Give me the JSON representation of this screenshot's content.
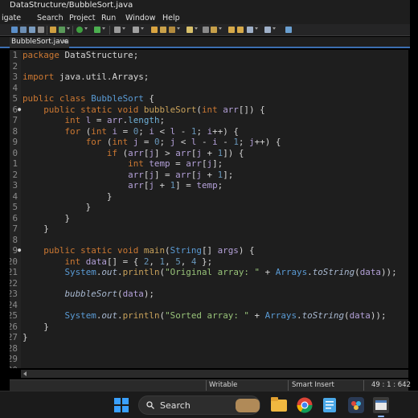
{
  "window": {
    "title": "DataStructure/BubbleSort.java"
  },
  "menu": [
    "igate",
    "Search",
    "Project",
    "Run",
    "Window",
    "Help"
  ],
  "tab": {
    "label": "BubbleSort.java",
    "close": "×"
  },
  "editor": {
    "lines": [
      {
        "n": "1",
        "fold": "",
        "t": [
          [
            "kw",
            "package"
          ],
          [
            "op",
            " DataStructure;"
          ]
        ]
      },
      {
        "n": "2",
        "fold": "",
        "t": []
      },
      {
        "n": "3",
        "fold": "",
        "t": [
          [
            "kw",
            "import"
          ],
          [
            "op",
            " java.util.Arrays;"
          ]
        ]
      },
      {
        "n": "4",
        "fold": "",
        "t": []
      },
      {
        "n": "5",
        "fold": "",
        "t": [
          [
            "kw",
            "public class "
          ],
          [
            "cls",
            "BubbleSort"
          ],
          [
            "op",
            " {"
          ]
        ]
      },
      {
        "n": "6",
        "fold": "●",
        "t": [
          [
            "op",
            "    "
          ],
          [
            "kw",
            "public static void "
          ],
          [
            "mth",
            "bubbleSort"
          ],
          [
            "op",
            "("
          ],
          [
            "ty",
            "int"
          ],
          [
            "op",
            " "
          ],
          [
            "var",
            "arr"
          ],
          [
            "op",
            "[]) {"
          ]
        ]
      },
      {
        "n": "7",
        "fold": "",
        "t": [
          [
            "op",
            "        "
          ],
          [
            "ty",
            "int"
          ],
          [
            "op",
            " "
          ],
          [
            "var",
            "l"
          ],
          [
            "op",
            " = "
          ],
          [
            "var",
            "arr"
          ],
          [
            "op",
            "."
          ],
          [
            "fld",
            "length"
          ],
          [
            "op",
            ";"
          ]
        ]
      },
      {
        "n": "8",
        "fold": "",
        "t": [
          [
            "op",
            "        "
          ],
          [
            "kw",
            "for"
          ],
          [
            "op",
            " ("
          ],
          [
            "ty",
            "int"
          ],
          [
            "op",
            " "
          ],
          [
            "var",
            "i"
          ],
          [
            "op",
            " = "
          ],
          [
            "num",
            "0"
          ],
          [
            "op",
            "; "
          ],
          [
            "var",
            "i"
          ],
          [
            "op",
            " < "
          ],
          [
            "var",
            "l"
          ],
          [
            "op",
            " - "
          ],
          [
            "num",
            "1"
          ],
          [
            "op",
            "; "
          ],
          [
            "var",
            "i"
          ],
          [
            "op",
            "++) {"
          ]
        ]
      },
      {
        "n": "9",
        "fold": "",
        "t": [
          [
            "op",
            "            "
          ],
          [
            "kw",
            "for"
          ],
          [
            "op",
            " ("
          ],
          [
            "ty",
            "int"
          ],
          [
            "op",
            " "
          ],
          [
            "var",
            "j"
          ],
          [
            "op",
            " = "
          ],
          [
            "num",
            "0"
          ],
          [
            "op",
            "; "
          ],
          [
            "var",
            "j"
          ],
          [
            "op",
            " < "
          ],
          [
            "var",
            "l"
          ],
          [
            "op",
            " - "
          ],
          [
            "var",
            "i"
          ],
          [
            "op",
            " - "
          ],
          [
            "num",
            "1"
          ],
          [
            "op",
            "; "
          ],
          [
            "var",
            "j"
          ],
          [
            "op",
            "++) {"
          ]
        ]
      },
      {
        "n": "0",
        "fold": "",
        "t": [
          [
            "op",
            "                "
          ],
          [
            "kw",
            "if"
          ],
          [
            "op",
            " ("
          ],
          [
            "var",
            "arr"
          ],
          [
            "op",
            "["
          ],
          [
            "var",
            "j"
          ],
          [
            "op",
            "] > "
          ],
          [
            "var",
            "arr"
          ],
          [
            "op",
            "["
          ],
          [
            "var",
            "j"
          ],
          [
            "op",
            " + "
          ],
          [
            "num",
            "1"
          ],
          [
            "op",
            "]) {"
          ]
        ]
      },
      {
        "n": "1",
        "fold": "",
        "t": [
          [
            "op",
            "                    "
          ],
          [
            "ty",
            "int"
          ],
          [
            "op",
            " "
          ],
          [
            "var",
            "temp"
          ],
          [
            "op",
            " = "
          ],
          [
            "var",
            "arr"
          ],
          [
            "op",
            "["
          ],
          [
            "var",
            "j"
          ],
          [
            "op",
            "];"
          ]
        ]
      },
      {
        "n": "2",
        "fold": "",
        "t": [
          [
            "op",
            "                    "
          ],
          [
            "var",
            "arr"
          ],
          [
            "op",
            "["
          ],
          [
            "var",
            "j"
          ],
          [
            "op",
            "] = "
          ],
          [
            "var",
            "arr"
          ],
          [
            "op",
            "["
          ],
          [
            "var",
            "j"
          ],
          [
            "op",
            " + "
          ],
          [
            "num",
            "1"
          ],
          [
            "op",
            "];"
          ]
        ]
      },
      {
        "n": "3",
        "fold": "",
        "t": [
          [
            "op",
            "                    "
          ],
          [
            "var",
            "arr"
          ],
          [
            "op",
            "["
          ],
          [
            "var",
            "j"
          ],
          [
            "op",
            " + "
          ],
          [
            "num",
            "1"
          ],
          [
            "op",
            "] = "
          ],
          [
            "var",
            "temp"
          ],
          [
            "op",
            ";"
          ]
        ]
      },
      {
        "n": "4",
        "fold": "",
        "t": [
          [
            "op",
            "                }"
          ]
        ]
      },
      {
        "n": "5",
        "fold": "",
        "t": [
          [
            "op",
            "            }"
          ]
        ]
      },
      {
        "n": "6",
        "fold": "",
        "t": [
          [
            "op",
            "        }"
          ]
        ]
      },
      {
        "n": "7",
        "fold": "",
        "t": [
          [
            "op",
            "    }"
          ]
        ]
      },
      {
        "n": "8",
        "fold": "",
        "t": []
      },
      {
        "n": "9",
        "fold": "●",
        "t": [
          [
            "op",
            "    "
          ],
          [
            "kw",
            "public static void "
          ],
          [
            "mth",
            "main"
          ],
          [
            "op",
            "("
          ],
          [
            "cls",
            "String"
          ],
          [
            "op",
            "[] "
          ],
          [
            "var",
            "args"
          ],
          [
            "op",
            ") {"
          ]
        ]
      },
      {
        "n": "20",
        "fold": "",
        "t": [
          [
            "op",
            "        "
          ],
          [
            "ty",
            "int"
          ],
          [
            "op",
            " "
          ],
          [
            "var",
            "data"
          ],
          [
            "op",
            "[] = { "
          ],
          [
            "num",
            "2"
          ],
          [
            "op",
            ", "
          ],
          [
            "num",
            "1"
          ],
          [
            "op",
            ", "
          ],
          [
            "num",
            "5"
          ],
          [
            "op",
            ", "
          ],
          [
            "num",
            "4"
          ],
          [
            "op",
            " };"
          ]
        ]
      },
      {
        "n": "21",
        "fold": "",
        "t": [
          [
            "op",
            "        "
          ],
          [
            "cls",
            "System"
          ],
          [
            "op",
            "."
          ],
          [
            "sm",
            "out"
          ],
          [
            "op",
            "."
          ],
          [
            "mth",
            "println"
          ],
          [
            "op",
            "("
          ],
          [
            "str",
            "\"Original array: \""
          ],
          [
            "op",
            " + "
          ],
          [
            "cls",
            "Arrays"
          ],
          [
            "op",
            "."
          ],
          [
            "sm",
            "toString"
          ],
          [
            "op",
            "("
          ],
          [
            "var",
            "data"
          ],
          [
            "op",
            "));"
          ]
        ]
      },
      {
        "n": "22",
        "fold": "",
        "t": []
      },
      {
        "n": "23",
        "fold": "",
        "t": [
          [
            "op",
            "        "
          ],
          [
            "sm",
            "bubbleSort"
          ],
          [
            "op",
            "("
          ],
          [
            "var",
            "data"
          ],
          [
            "op",
            ");"
          ]
        ]
      },
      {
        "n": "24",
        "fold": "",
        "t": []
      },
      {
        "n": "25",
        "fold": "",
        "t": [
          [
            "op",
            "        "
          ],
          [
            "cls",
            "System"
          ],
          [
            "op",
            "."
          ],
          [
            "sm",
            "out"
          ],
          [
            "op",
            "."
          ],
          [
            "mth",
            "println"
          ],
          [
            "op",
            "("
          ],
          [
            "str",
            "\"Sorted array: \""
          ],
          [
            "op",
            " + "
          ],
          [
            "cls",
            "Arrays"
          ],
          [
            "op",
            "."
          ],
          [
            "sm",
            "toString"
          ],
          [
            "op",
            "("
          ],
          [
            "var",
            "data"
          ],
          [
            "op",
            "));"
          ]
        ]
      },
      {
        "n": "26",
        "fold": "",
        "t": [
          [
            "op",
            "    }"
          ]
        ]
      },
      {
        "n": "27",
        "fold": "",
        "t": [
          [
            "op",
            "}"
          ]
        ]
      },
      {
        "n": "28",
        "fold": "",
        "t": []
      },
      {
        "n": "29",
        "fold": "",
        "t": []
      },
      {
        "n": "30",
        "fold": "",
        "t": []
      }
    ]
  },
  "status": {
    "mode": "Writable",
    "insert": "Smart Insert",
    "position": "49 : 1 : 642"
  },
  "taskbar": {
    "search_label": "Search"
  },
  "colors": {
    "accent": "#3c6fb1",
    "editor_bg": "#1e1e1e",
    "keyword": "#cc7832",
    "string": "#98c379"
  }
}
